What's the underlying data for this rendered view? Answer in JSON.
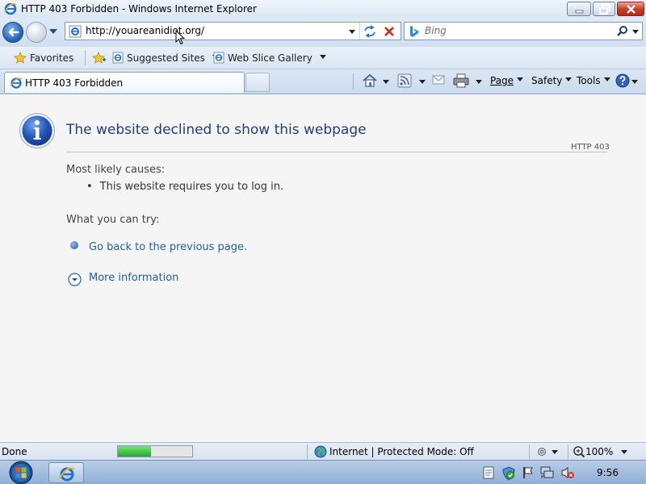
{
  "window": {
    "title": "HTTP 403 Forbidden - Windows Internet Explorer",
    "app_icon": "ie-icon"
  },
  "navigation": {
    "url": "http://youareanidiot.org/",
    "search_placeholder": "Bing",
    "icons": [
      "back-icon",
      "forward-icon",
      "recent-pages-dropdown-icon",
      "refresh-icon",
      "stop-icon",
      "search-icon"
    ]
  },
  "favorites_bar": {
    "favorites_label": "Favorites",
    "items": [
      {
        "label": "Suggested Sites",
        "icon": "ie-page-icon"
      },
      {
        "label": "Web Slice Gallery",
        "icon": "ie-page-icon"
      }
    ]
  },
  "tabs": [
    {
      "label": "HTTP 403 Forbidden",
      "icon": "ie-page-icon",
      "active": true
    }
  ],
  "command_bar": {
    "page_label": "Page",
    "safety_label": "Safety",
    "tools_label": "Tools",
    "icons": [
      "home-icon",
      "feeds-icon",
      "read-mail-icon",
      "print-icon",
      "help-icon"
    ]
  },
  "content": {
    "title": "The website declined to show this webpage",
    "code": "HTTP 403",
    "causes_heading": "Most likely causes:",
    "causes": [
      "This website requires you to log in."
    ],
    "try_heading": "What you can try:",
    "go_back_link": "Go back to the previous page.",
    "more_info_link": "More information"
  },
  "status_bar": {
    "status": "Done",
    "progress": 0.45,
    "zone": "Internet | Protected Mode: Off",
    "zoom": "100%"
  },
  "taskbar": {
    "clock": "9:56",
    "pinned": [
      "ie-icon"
    ]
  },
  "colors": {
    "title_text": "#1f3f7a",
    "link": "#1f5fa8",
    "content_background": "#f5f5f5",
    "progress_fill": "#1eaa2b"
  }
}
